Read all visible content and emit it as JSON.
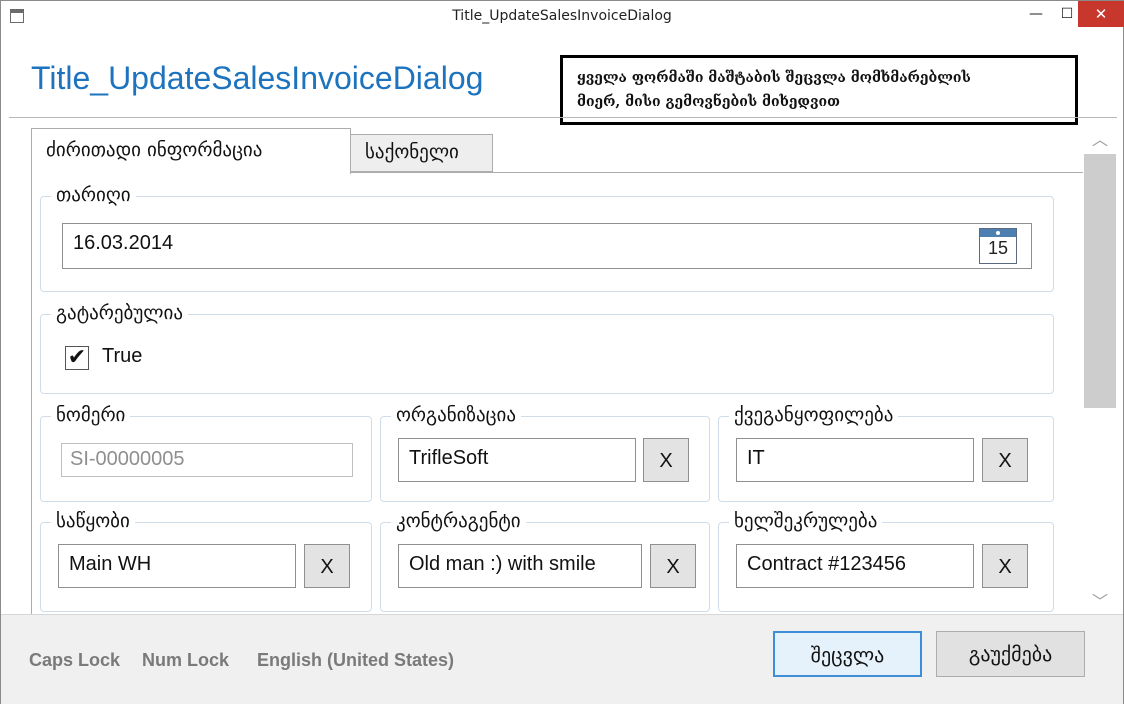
{
  "window": {
    "title": "Title_UpdateSalesInvoiceDialog",
    "minimize": "—",
    "maximize": "☐",
    "close": "✕"
  },
  "header": {
    "title": "Title_UpdateSalesInvoiceDialog",
    "note_line1": "ყველა ფორმაში მაშტაბის შეცვლა მომხმარებლის",
    "note_line2": "მიერ, მისი გემოვნების მიხედვით"
  },
  "tabs": [
    {
      "label": "ძირითადი ინფორმაცია",
      "active": true
    },
    {
      "label": "საქონელი",
      "active": false
    }
  ],
  "form": {
    "date": {
      "label": "თარიღი",
      "value": "16.03.2014",
      "calendar_day": "15"
    },
    "posted": {
      "label": "გატარებულია",
      "checked": true,
      "check_mark": "✔",
      "value_label": "True"
    },
    "number": {
      "label": "ნომერი",
      "value": "SI-00000005"
    },
    "organization": {
      "label": "ორგანიზაცია",
      "value": "TrifleSoft",
      "clear": "X"
    },
    "department": {
      "label": "ქვეგანყოფილება",
      "value": "IT",
      "clear": "X"
    },
    "warehouse": {
      "label": "საწყობი",
      "value": "Main WH",
      "clear": "X"
    },
    "counterparty": {
      "label": "კონტრაგენტი",
      "value": "Old man :) with smile",
      "clear": "X"
    },
    "contract": {
      "label": "ხელშეკრულება",
      "value": "Contract #123456",
      "clear": "X"
    }
  },
  "scrollbar": {
    "up": "︿",
    "down": "﹀"
  },
  "status": {
    "caps": "Caps Lock",
    "num": "Num Lock",
    "language": "English (United States)"
  },
  "buttons": {
    "ok": "შეცვლა",
    "cancel": "გაუქმება"
  },
  "colors": {
    "title_blue": "#1e73be",
    "close_red": "#c7372c",
    "primary_border": "#3c8fd6"
  }
}
